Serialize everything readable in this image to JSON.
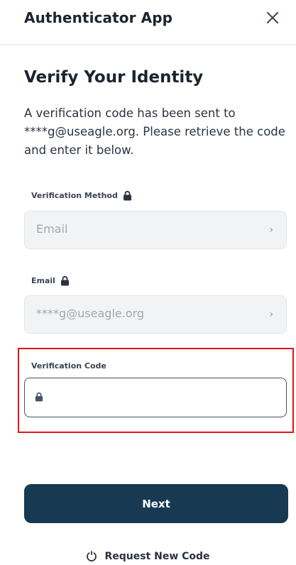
{
  "header": {
    "title": "Authenticator App",
    "close_icon": "close-icon"
  },
  "main": {
    "title": "Verify Your Identity",
    "description": "A verification code has been sent to ****g@useagle.org. Please retrieve the code and enter it below."
  },
  "fields": {
    "method": {
      "label": "Verification Method",
      "value": "Email",
      "locked": true
    },
    "email": {
      "label": "Email",
      "value": "****g@useagle.org",
      "locked": true
    },
    "code": {
      "label": "Verification Code",
      "value": "",
      "placeholder": ""
    }
  },
  "actions": {
    "next_label": "Next",
    "request_label": "Request New Code"
  },
  "colors": {
    "primary_button": "#173a52",
    "highlight_border": "#e0131b",
    "locked_field_bg": "#f2f3f4"
  }
}
